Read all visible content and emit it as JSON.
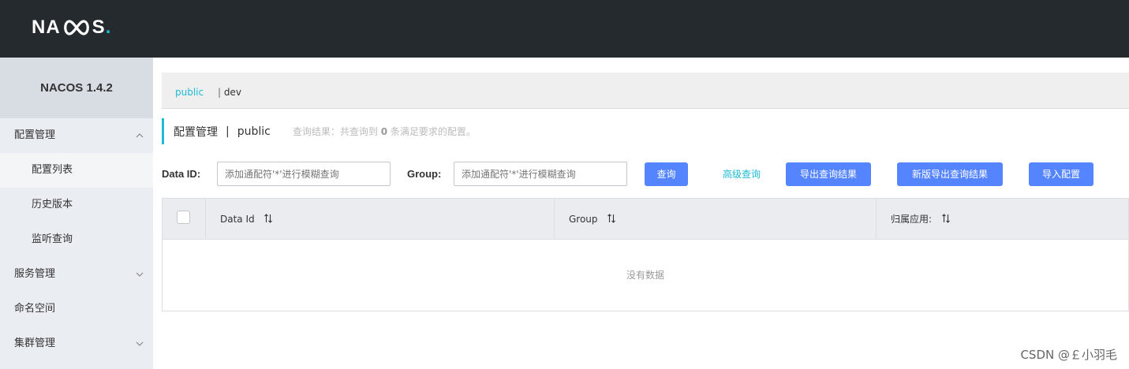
{
  "header": {
    "logo_pre": "NA",
    "logo_post": "S",
    "logo_dot": "."
  },
  "sidebar": {
    "version": "NACOS 1.4.2",
    "items": [
      {
        "label": "配置管理",
        "type": "group",
        "expanded": true
      },
      {
        "label": "配置列表",
        "type": "sub",
        "active": true
      },
      {
        "label": "历史版本",
        "type": "sub"
      },
      {
        "label": "监听查询",
        "type": "sub"
      },
      {
        "label": "服务管理",
        "type": "group",
        "expanded": false
      },
      {
        "label": "命名空间",
        "type": "item"
      },
      {
        "label": "集群管理",
        "type": "group",
        "expanded": false
      }
    ]
  },
  "namespace": {
    "active": "public",
    "other": "dev",
    "separator": "|"
  },
  "title": {
    "main": "配置管理",
    "separator": "|",
    "namespace": "public",
    "info_pre": "查询结果：共查询到",
    "info_count": "0",
    "info_post": "条满足要求的配置。"
  },
  "search": {
    "dataid_label": "Data ID:",
    "dataid_placeholder": "添加通配符'*'进行模糊查询",
    "group_label": "Group:",
    "group_placeholder": "添加通配符'*'进行模糊查询",
    "query_button": "查询",
    "advanced_link": "高级查询",
    "export_button": "导出查询结果",
    "new_export_button": "新版导出查询结果",
    "import_button": "导入配置"
  },
  "table": {
    "columns": [
      "Data Id",
      "Group",
      "归属应用:"
    ],
    "empty_text": "没有数据"
  },
  "watermark": "CSDN @￡小羽毛",
  "colors": {
    "header": "#252a2f",
    "accent": "#1fbad6",
    "primary_button": "#5584ff"
  }
}
